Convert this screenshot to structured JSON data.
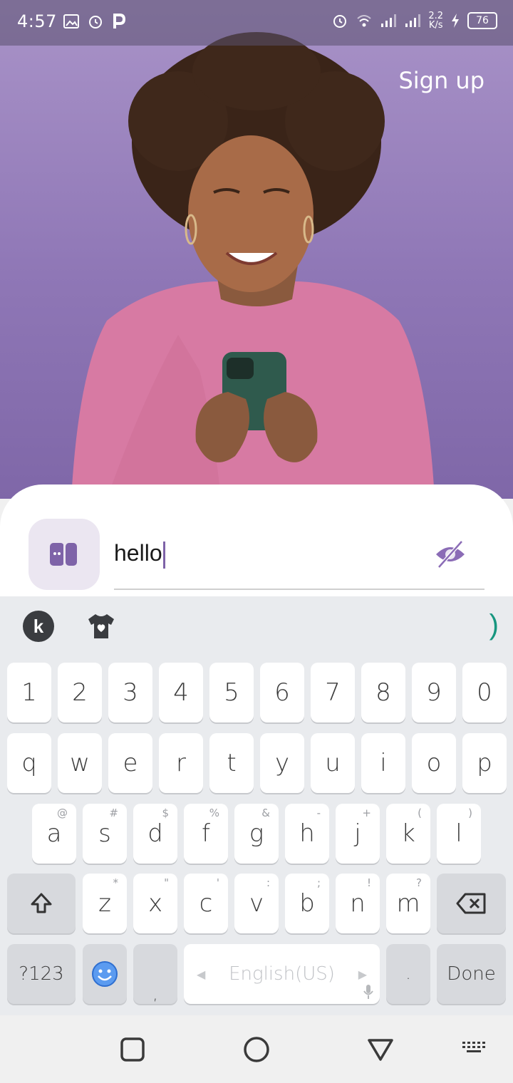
{
  "status_bar": {
    "time": "4:57",
    "speed_value": "2.2",
    "speed_unit": "K/s",
    "battery": "76"
  },
  "header": {
    "signup_label": "Sign up"
  },
  "login": {
    "password_value": "hello"
  },
  "keyboard": {
    "number_row": [
      "1",
      "2",
      "3",
      "4",
      "5",
      "6",
      "7",
      "8",
      "9",
      "0"
    ],
    "row1": [
      "q",
      "w",
      "e",
      "r",
      "t",
      "y",
      "u",
      "i",
      "o",
      "p"
    ],
    "row2": [
      {
        "key": "a",
        "hint": "@"
      },
      {
        "key": "s",
        "hint": "#"
      },
      {
        "key": "d",
        "hint": "$"
      },
      {
        "key": "f",
        "hint": "%"
      },
      {
        "key": "g",
        "hint": "&"
      },
      {
        "key": "h",
        "hint": "-"
      },
      {
        "key": "j",
        "hint": "+"
      },
      {
        "key": "k",
        "hint": "("
      },
      {
        "key": "l",
        "hint": ")"
      }
    ],
    "row3": [
      {
        "key": "z",
        "hint": "*"
      },
      {
        "key": "x",
        "hint": "\""
      },
      {
        "key": "c",
        "hint": "'"
      },
      {
        "key": "v",
        "hint": ":"
      },
      {
        "key": "b",
        "hint": ";"
      },
      {
        "key": "n",
        "hint": "!"
      },
      {
        "key": "m",
        "hint": "?"
      }
    ],
    "symbols_label": "?123",
    "comma_label": ",",
    "space_label": "English(US)",
    "period_label": ".",
    "done_label": "Done",
    "accent_color": "#17967f"
  },
  "colors": {
    "brand_purple": "#7e63a8",
    "hero_bg": "#9b83bd"
  }
}
